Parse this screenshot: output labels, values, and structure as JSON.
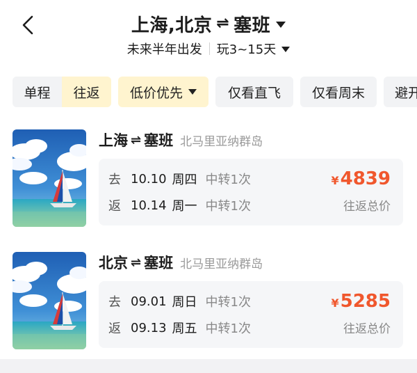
{
  "header": {
    "origins": "上海,北京",
    "arrows": "⇌",
    "destination": "塞班",
    "time_range": "未来半年出发",
    "duration": "玩3~15天"
  },
  "filters": {
    "trip_type": [
      "单程",
      "往返"
    ],
    "active_trip_type": "往返",
    "sort": "低价优先",
    "direct": "仅看直飞",
    "weekend": "仅看周末",
    "more": "避开"
  },
  "results": [
    {
      "origin": "上海",
      "destination": "塞班",
      "region": "北马里亚纳群岛",
      "outbound": {
        "label": "去",
        "date": "10.10",
        "weekday": "周四",
        "transfer": "中转1次"
      },
      "return": {
        "label": "返",
        "date": "10.14",
        "weekday": "周一",
        "transfer": "中转1次"
      },
      "currency": "¥",
      "price": "4839",
      "price_label": "往返总价"
    },
    {
      "origin": "北京",
      "destination": "塞班",
      "region": "北马里亚纳群岛",
      "outbound": {
        "label": "去",
        "date": "09.01",
        "weekday": "周日",
        "transfer": "中转1次"
      },
      "return": {
        "label": "返",
        "date": "09.13",
        "weekday": "周五",
        "transfer": "中转1次"
      },
      "currency": "¥",
      "price": "5285",
      "price_label": "往返总价"
    }
  ],
  "colors": {
    "accent_price": "#f0572d",
    "active_chip_bg": "#fff4cf",
    "chip_bg": "#f2f3f5"
  },
  "icons": {
    "back": "back-arrow-icon",
    "title_dropdown": "caret-down-icon",
    "destination_image": "beach-sailboat-photo"
  }
}
